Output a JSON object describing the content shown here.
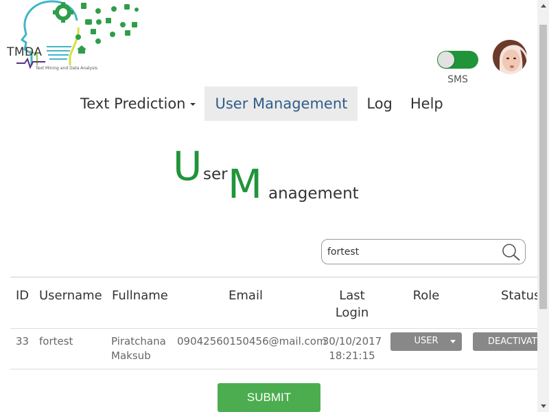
{
  "logo": {
    "title": "TMDA",
    "subtitle": "Text Mining and Data Analysis"
  },
  "toggle": {
    "label": "SMS",
    "on": true
  },
  "nav": {
    "items": [
      {
        "label": "Text Prediction",
        "dropdown": true
      },
      {
        "label": "User Management",
        "active": true
      },
      {
        "label": "Log"
      },
      {
        "label": "Help"
      }
    ]
  },
  "heading": {
    "letter1": "U",
    "rest1": "ser",
    "letter2": "M",
    "rest2": "anagement"
  },
  "search": {
    "value": "fortest"
  },
  "table": {
    "headers": {
      "id": "ID",
      "username": "Username",
      "fullname": "Fullname",
      "email": "Email",
      "last_login_1": "Last",
      "last_login_2": "Login",
      "role": "Role",
      "status": "Status"
    },
    "rows": [
      {
        "id": "33",
        "username": "fortest",
        "first_name": "Piratchana",
        "last_name": "Maksub",
        "email": "09042560150456@mail.com",
        "date": "30/10/2017",
        "time": "18:21:15",
        "role": "USER",
        "status": "DEACTIVATE"
      }
    ]
  },
  "submit_label": "SUBMIT",
  "colors": {
    "accent_green": "#21943a",
    "button_green": "#4cad50",
    "nav_active_text": "#2f5c8a",
    "nav_active_bg": "#ebebeb",
    "control_gray": "#888888"
  }
}
